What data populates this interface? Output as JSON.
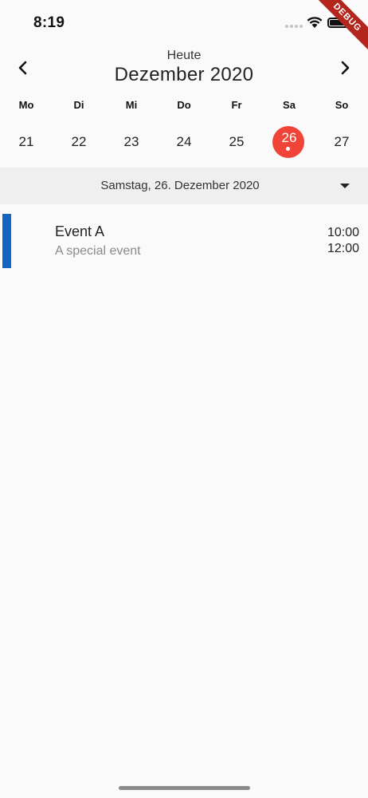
{
  "status_bar": {
    "time": "8:19",
    "icons": [
      "signal-icon",
      "wifi-icon",
      "battery-icon"
    ]
  },
  "debug_banner": "DEBUG",
  "header": {
    "today_label": "Heute",
    "month_title": "Dezember 2020",
    "prev_icon": "chevron-left-icon",
    "next_icon": "chevron-right-icon"
  },
  "week": {
    "days": [
      {
        "weekday": "Mo",
        "date": "21"
      },
      {
        "weekday": "Di",
        "date": "22"
      },
      {
        "weekday": "Mi",
        "date": "23"
      },
      {
        "weekday": "Do",
        "date": "24"
      },
      {
        "weekday": "Fr",
        "date": "25"
      },
      {
        "weekday": "Sa",
        "date": "26"
      },
      {
        "weekday": "So",
        "date": "27"
      }
    ],
    "selected_color": "#f04438"
  },
  "selected_date": {
    "label": "Samstag, 26. Dezember 2020",
    "icon": "dropdown-arrow-icon"
  },
  "events": [
    {
      "title": "Event A",
      "subtitle": "A special event",
      "start": "10:00",
      "end": "12:00",
      "color": "#1565c0"
    }
  ]
}
